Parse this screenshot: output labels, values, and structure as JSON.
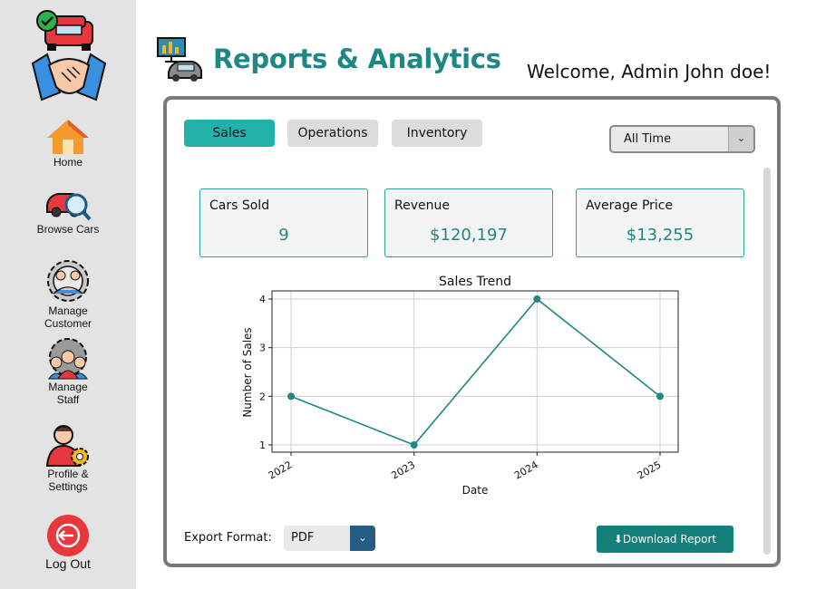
{
  "sidebar": {
    "items": [
      {
        "label_line1": "Home",
        "label_line2": ""
      },
      {
        "label_line1": "Browse Cars",
        "label_line2": ""
      },
      {
        "label_line1": "Manage",
        "label_line2": "Customer"
      },
      {
        "label_line1": "Manage",
        "label_line2": "Staff"
      },
      {
        "label_line1": "Profile &",
        "label_line2": "Settings"
      },
      {
        "label_line1": "Log Out",
        "label_line2": ""
      }
    ]
  },
  "header": {
    "title": "Reports & Analytics",
    "welcome": "Welcome, Admin John doe!"
  },
  "tabs": [
    {
      "label": "Sales",
      "active": true
    },
    {
      "label": "Operations",
      "active": false
    },
    {
      "label": "Inventory",
      "active": false
    }
  ],
  "time_filter": {
    "value": "All Time"
  },
  "stats": [
    {
      "label": "Cars Sold",
      "value": "9"
    },
    {
      "label": "Revenue",
      "value": "$120,197"
    },
    {
      "label": "Average Price",
      "value": "$13,255"
    }
  ],
  "chart_data": {
    "type": "line",
    "title": "Sales Trend",
    "xlabel": "Date",
    "ylabel": "Number of Sales",
    "categories": [
      "2022",
      "2023",
      "2024",
      "2025"
    ],
    "values": [
      2,
      1,
      4,
      2
    ],
    "y_ticks": [
      "1",
      "2",
      "3",
      "4"
    ],
    "ylim": [
      1,
      4
    ],
    "grid": true,
    "color": "#1f8784"
  },
  "export": {
    "label": "Export Format:",
    "value": "PDF",
    "download_label": "⬇Download Report"
  },
  "colors": {
    "accent": "#1f8784",
    "tab_active": "#22b2a9",
    "sidebar_bg": "#e3e3e3"
  }
}
